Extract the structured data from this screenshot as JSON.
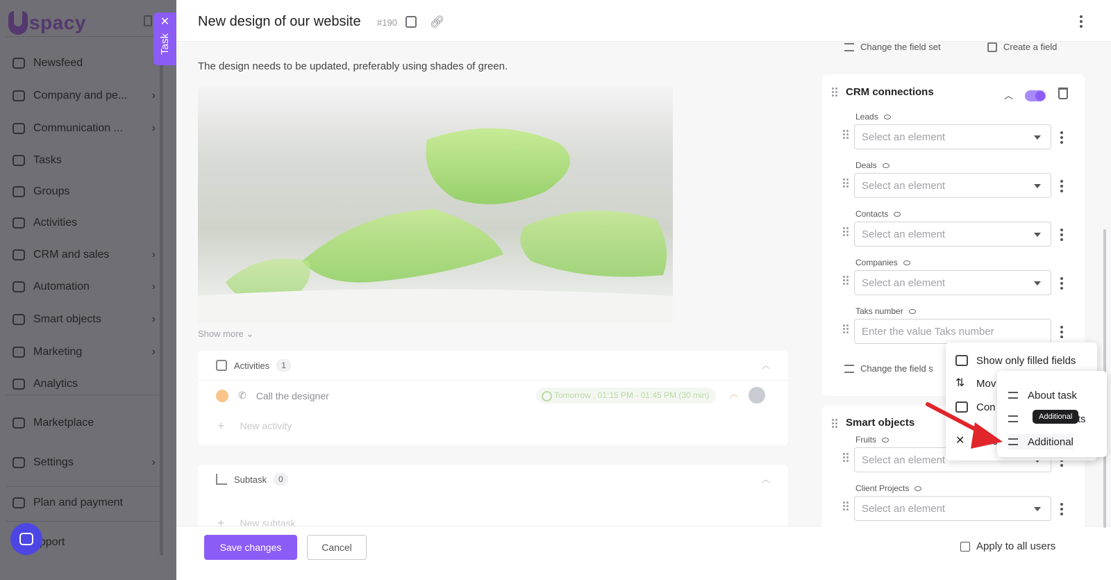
{
  "sidebar": {
    "logo_text": "spacy",
    "items": [
      {
        "label": "Newsfeed",
        "icon": "home-icon",
        "chevron": false
      },
      {
        "label": "Company and pe...",
        "icon": "building-icon",
        "chevron": true
      },
      {
        "label": "Communication ...",
        "icon": "chat-edit-icon",
        "chevron": true
      },
      {
        "label": "Tasks",
        "icon": "check-circle-icon",
        "chevron": false
      },
      {
        "label": "Groups",
        "icon": "users-icon",
        "chevron": false
      },
      {
        "label": "Activities",
        "icon": "calendar-icon",
        "chevron": false
      },
      {
        "label": "CRM and sales",
        "icon": "database-icon",
        "chevron": true
      },
      {
        "label": "Automation",
        "icon": "bolt-icon",
        "chevron": true
      },
      {
        "label": "Smart objects",
        "icon": "smart-object-icon",
        "chevron": true
      },
      {
        "label": "Marketing",
        "icon": "megaphone-icon",
        "chevron": true
      },
      {
        "label": "Analytics",
        "icon": "analytics-icon",
        "chevron": false
      },
      {
        "label": "Marketplace",
        "icon": "store-icon",
        "chevron": false
      },
      {
        "label": "Settings",
        "icon": "gear-icon",
        "chevron": true
      },
      {
        "label": "Plan and payment",
        "icon": "wallet-icon",
        "chevron": false
      },
      {
        "label": "upport",
        "icon": "chat-bubble-icon",
        "chevron": false
      }
    ]
  },
  "task_tab": {
    "label": "Task",
    "close": "✕"
  },
  "header": {
    "title": "New design of our website",
    "task_number": "#190"
  },
  "description": "The design needs to be updated, preferably using shades of green.",
  "show_more": "Show more ⌄",
  "activities": {
    "label": "Activities",
    "count": "1",
    "item": {
      "text": "Call the designer",
      "time": "Tomorrow , 01:15 PM - 01:45 PM (30 min)"
    },
    "new_label": "New activity"
  },
  "subtask": {
    "label": "Subtask",
    "count": "0",
    "new_label": "New subtask"
  },
  "footer": {
    "save": "Save changes",
    "cancel": "Cancel",
    "apply_all": "Apply to all users"
  },
  "right": {
    "change_field_set": "Change the field set",
    "create_field": "Create a field",
    "crm_title": "CRM connections",
    "crm_fields": [
      {
        "label": "Leads",
        "placeholder": "Select an element"
      },
      {
        "label": "Deals",
        "placeholder": "Select an element"
      },
      {
        "label": "Contacts",
        "placeholder": "Select an element"
      },
      {
        "label": "Companies",
        "placeholder": "Select an element"
      },
      {
        "label": "Taks number",
        "placeholder": "Enter the value Taks number"
      }
    ],
    "change_field_set_trunc": "Change the field s",
    "smart_title": "Smart objects",
    "smart_fields": [
      {
        "label": "Fruits",
        "placeholder": "Select an element"
      },
      {
        "label": "Client Projects",
        "placeholder": "Select an element"
      }
    ]
  },
  "menu1": {
    "show_filled": "Show only filled fields",
    "move": "Mov",
    "con": "Con",
    "hide": "Hide"
  },
  "menu2": {
    "about_task": "About task",
    "smart_objects_part": "ects",
    "additional": "Additional",
    "tooltip": "Additional"
  },
  "colors": {
    "accent": "#8b5cf6",
    "annotation_arrow": "#e0262b"
  }
}
